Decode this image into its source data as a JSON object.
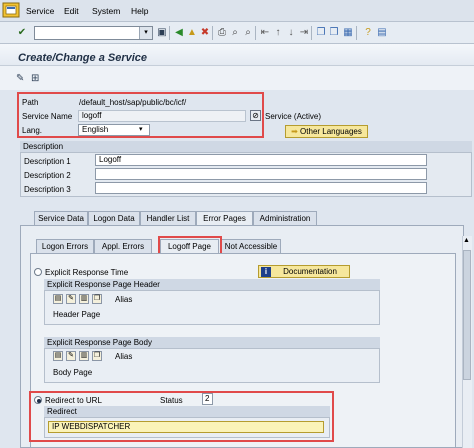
{
  "menu": {
    "items": [
      "Service",
      "Edit",
      "System",
      "Help"
    ]
  },
  "page": {
    "title": "Create/Change a Service"
  },
  "service": {
    "path_label": "Path",
    "path_value": "/default_host/sap/public/bc/icf/",
    "name_label": "Service Name",
    "name_value": "logoff",
    "status_text": "Service (Active)",
    "lang_label": "Lang.",
    "lang_value": "English",
    "other_languages_label": "Other Languages"
  },
  "description": {
    "header": "Description",
    "rows": [
      {
        "label": "Description 1",
        "value": "Logoff"
      },
      {
        "label": "Description 2",
        "value": ""
      },
      {
        "label": "Description 3",
        "value": ""
      }
    ]
  },
  "tabs": {
    "main": [
      "Service Data",
      "Logon Data",
      "Handler List",
      "Error Pages",
      "Administration"
    ],
    "sub": [
      "Logon Errors",
      "Appl. Errors",
      "Logoff Page",
      "Not Accessible"
    ]
  },
  "logoff": {
    "explicit_label": "Explicit Response Time",
    "documentation_label": "Documentation",
    "header_group": "Explicit Response Page Header",
    "header_alias": "Alias",
    "header_page": "Header Page",
    "body_group": "Explicit Response Page Body",
    "body_alias": "Alias",
    "body_page": "Body Page",
    "redirect_label": "Redirect to URL",
    "status_label": "Status",
    "status_value": "2",
    "redirect_group": "Redirect",
    "redirect_value": "IP WEBDISPATCHER"
  },
  "icons": {
    "toolbar": [
      "check-icon",
      "save-icon",
      "back-icon",
      "exit-icon",
      "cancel-icon",
      "print-icon",
      "find-icon",
      "find-next-icon",
      "first-page-icon",
      "prev-page-icon",
      "next-page-icon",
      "last-page-icon",
      "create-session-icon",
      "shortcut-icon",
      "help-icon",
      "customize-icon"
    ]
  },
  "colors": {
    "highlight_red": "#e04a4a",
    "button_yellow": "#f6e79c",
    "title_blue": "#1f2f45"
  }
}
